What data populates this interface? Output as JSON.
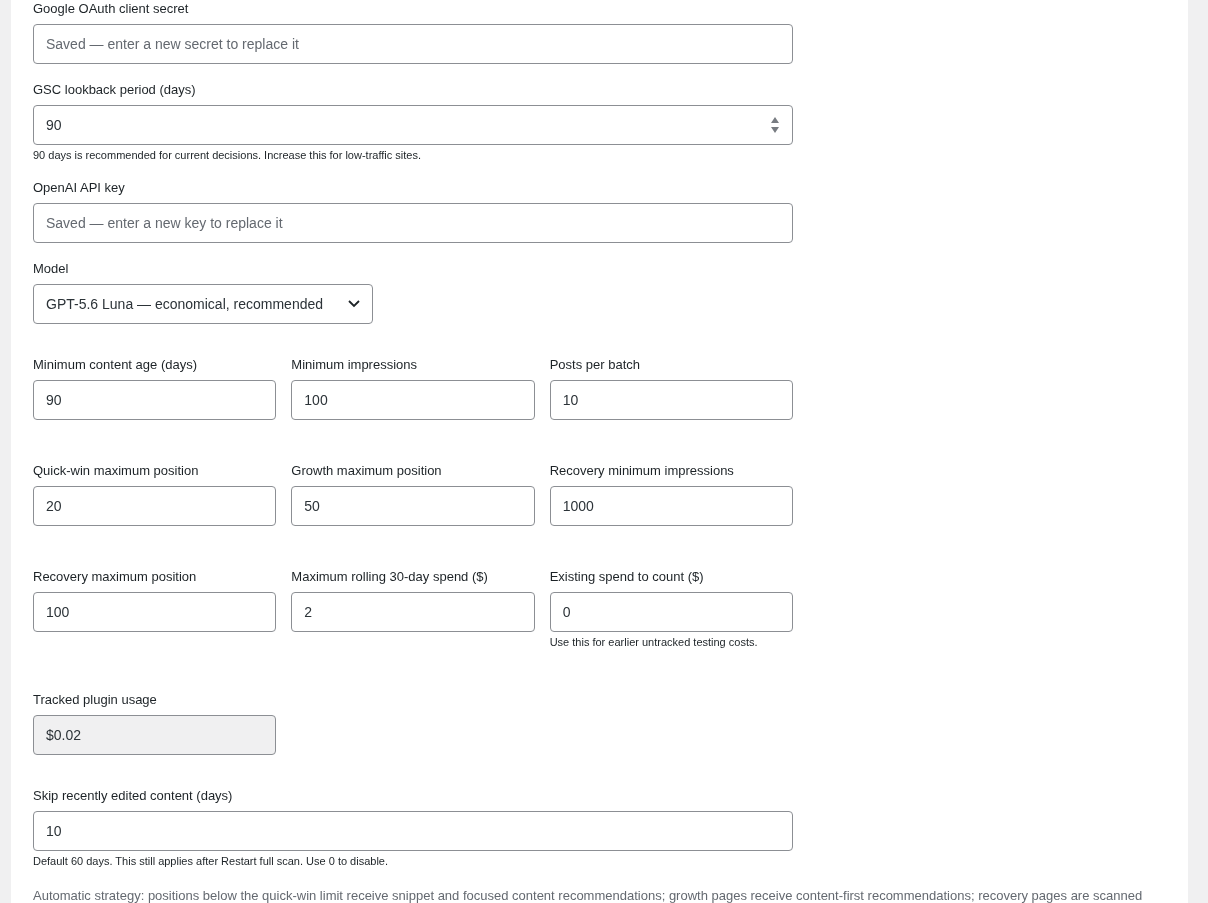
{
  "blocks": [
    {
      "kind": "text",
      "label": "Google OAuth client secret",
      "placeholder": "Saved — enter a new secret to replace it"
    },
    {
      "kind": "number",
      "label": "GSC lookback period (days)",
      "value": "90",
      "help": "90 days is recommended for current decisions. Increase this for low-traffic sites."
    },
    {
      "kind": "text",
      "label": "OpenAI API key",
      "placeholder": "Saved — enter a new key to replace it"
    },
    {
      "kind": "select",
      "label": "Model",
      "value": "GPT-5.6 Luna — economical, recommended"
    },
    {
      "kind": "row",
      "fields": [
        {
          "label": "Minimum content age (days)",
          "value": "90"
        },
        {
          "label": "Minimum impressions",
          "value": "100"
        },
        {
          "label": "Posts per batch",
          "value": "10"
        }
      ]
    },
    {
      "kind": "row",
      "fields": [
        {
          "label": "Quick-win maximum position",
          "value": "20"
        },
        {
          "label": "Growth maximum position",
          "value": "50"
        },
        {
          "label": "Recovery minimum impressions",
          "value": "1000"
        }
      ]
    },
    {
      "kind": "row",
      "fields": [
        {
          "label": "Recovery maximum position",
          "value": "100"
        },
        {
          "label": "Maximum rolling 30-day spend ($)",
          "value": "2"
        },
        {
          "label": "Existing spend to count ($)",
          "value": "0",
          "help": "Use this for earlier untracked testing costs."
        }
      ]
    },
    {
      "kind": "readonly",
      "label": "Tracked plugin usage",
      "value": "$0.02"
    },
    {
      "kind": "text",
      "label": "Skip recently edited content (days)",
      "value": "10",
      "help": "Default 60 days. This still applies after Restart full scan. Use 0 to disable."
    }
  ],
  "note": "Automatic strategy: positions below the quick-win limit receive snippet and focused content recommendations; growth pages receive content-first recommendations; recovery pages are scanned"
}
